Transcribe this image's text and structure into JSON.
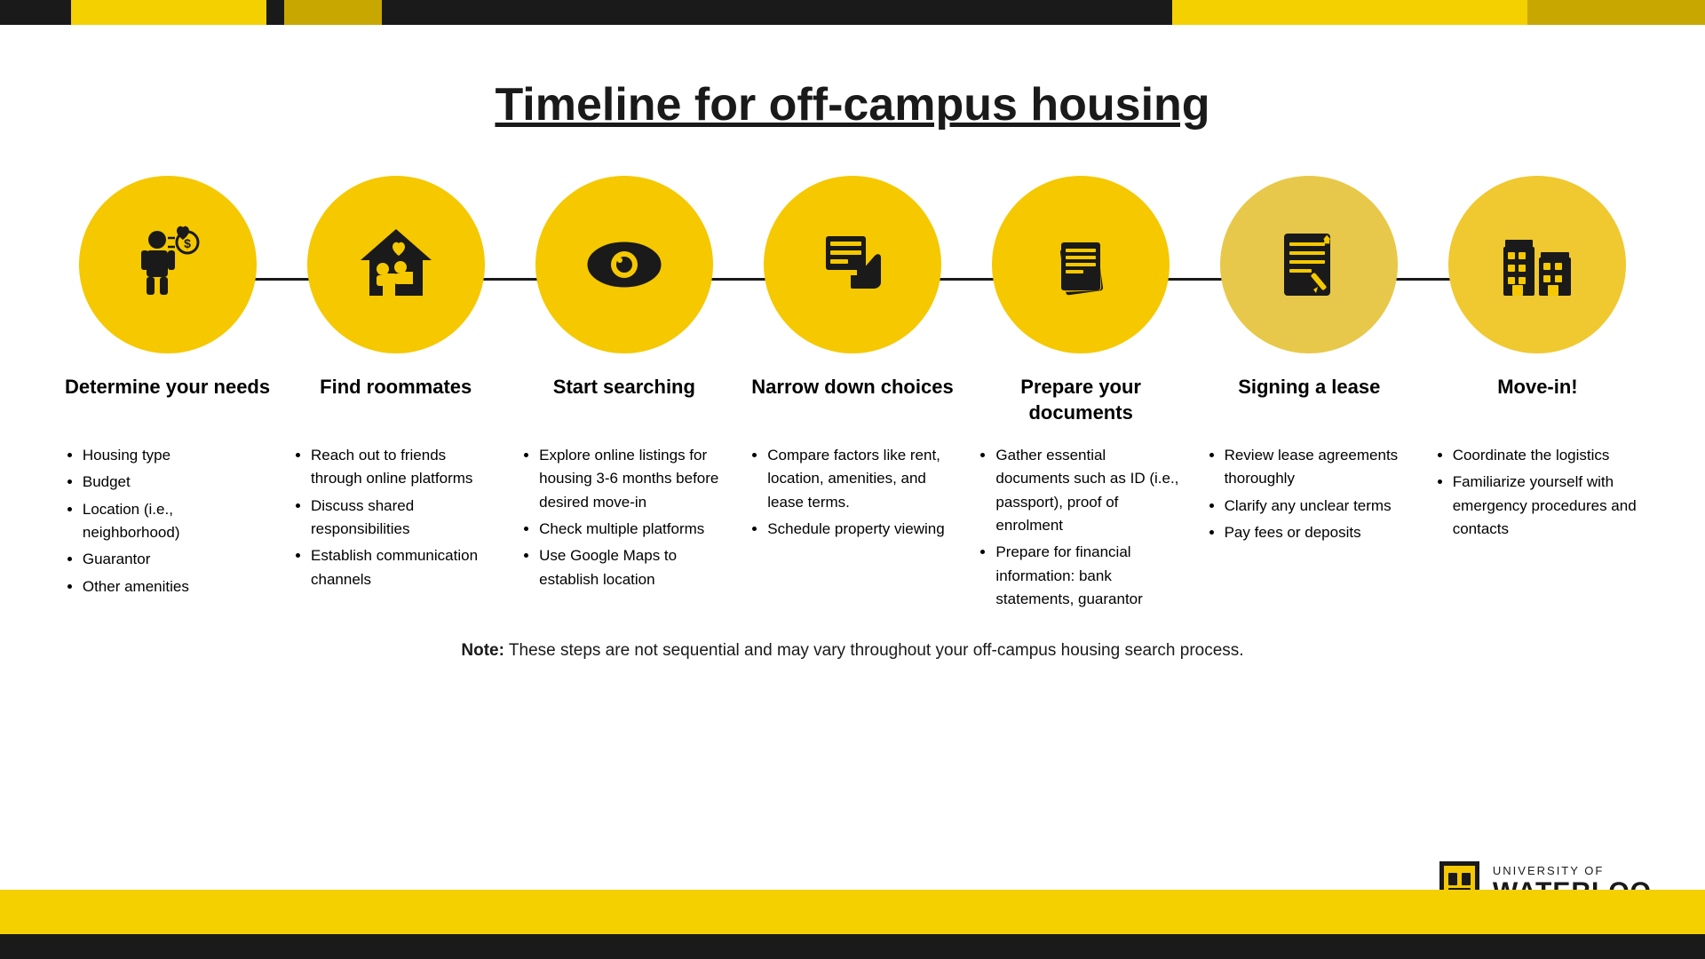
{
  "topbar": {},
  "title": "Timeline for off-campus housing",
  "steps": [
    {
      "id": "determine-needs",
      "title": "Determine your needs",
      "bullets": [
        "Housing type",
        "Budget",
        "Location (i.e., neighborhood)",
        "Guarantor",
        "Other amenities"
      ]
    },
    {
      "id": "find-roommates",
      "title": "Find roommates",
      "bullets": [
        "Reach out to friends through online platforms",
        "Discuss shared responsibilities",
        "Establish communication channels"
      ]
    },
    {
      "id": "start-searching",
      "title": "Start searching",
      "bullets": [
        "Explore online listings for housing 3-6 months before desired move-in",
        "Check multiple platforms",
        "Use Google Maps to establish location"
      ]
    },
    {
      "id": "narrow-down",
      "title": "Narrow down choices",
      "bullets": [
        "Compare factors like rent, location, amenities, and lease terms.",
        "Schedule property viewing"
      ]
    },
    {
      "id": "prepare-documents",
      "title": "Prepare your documents",
      "bullets": [
        "Gather essential documents such as ID (i.e., passport), proof of enrolment",
        "Prepare for financial information: bank statements, guarantor"
      ]
    },
    {
      "id": "signing-lease",
      "title": "Signing a lease",
      "bullets": [
        "Review lease agreements thoroughly",
        "Clarify any unclear terms",
        "Pay fees or deposits"
      ]
    },
    {
      "id": "move-in",
      "title": "Move-in!",
      "bullets": [
        "Coordinate the logistics",
        "Familiarize yourself with emergency procedures and contacts"
      ]
    }
  ],
  "note": "These steps are not sequential and may vary throughout your off-campus housing search process.",
  "note_label": "Note:",
  "uw": {
    "university_of": "UNIVERSITY OF",
    "waterloo": "WATERLOO"
  }
}
